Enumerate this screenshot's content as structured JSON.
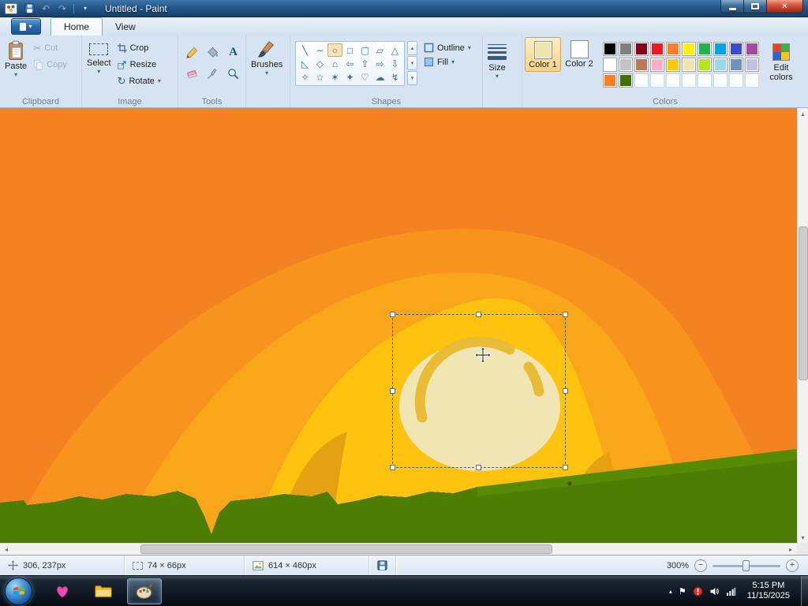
{
  "window": {
    "title": "Untitled - Paint"
  },
  "icons": {
    "undo": "↶",
    "redo": "↷",
    "dropdown": "▾",
    "close": "✕",
    "cut": "✂",
    "rotate": "↻",
    "text_tool": "A",
    "scroll_up": "▴",
    "scroll_down": "▾",
    "scroll_left": "◂",
    "scroll_right": "▸",
    "tray_expand": "▴",
    "action_center_flag": "⚑",
    "zoom_out": "−",
    "zoom_in": "+"
  },
  "tabs": {
    "home": "Home",
    "view": "View"
  },
  "ribbon": {
    "clipboard": {
      "label": "Clipboard",
      "paste": "Paste",
      "cut": "Cut",
      "copy": "Copy"
    },
    "image": {
      "label": "Image",
      "select": "Select",
      "crop": "Crop",
      "resize": "Resize",
      "rotate": "Rotate"
    },
    "tools": {
      "label": "Tools"
    },
    "brushes": {
      "label": "Brushes"
    },
    "shapes": {
      "label": "Shapes",
      "outline": "Outline",
      "fill": "Fill",
      "items": [
        {
          "name": "line",
          "glyph": "╲"
        },
        {
          "name": "curve",
          "glyph": "∼"
        },
        {
          "name": "oval",
          "glyph": "○",
          "selected": true
        },
        {
          "name": "rectangle",
          "glyph": "□"
        },
        {
          "name": "rounded-rectangle",
          "glyph": "▢"
        },
        {
          "name": "polygon",
          "glyph": "▱"
        },
        {
          "name": "triangle",
          "glyph": "△"
        },
        {
          "name": "right-triangle",
          "glyph": "◺"
        },
        {
          "name": "diamond",
          "glyph": "◇"
        },
        {
          "name": "pentagon",
          "glyph": "⌂"
        },
        {
          "name": "left-arrow",
          "glyph": "⇦"
        },
        {
          "name": "up-arrow",
          "glyph": "⇧"
        },
        {
          "name": "right-arrow",
          "glyph": "⇨"
        },
        {
          "name": "down-arrow",
          "glyph": "⇩"
        },
        {
          "name": "four-point-star",
          "glyph": "✧"
        },
        {
          "name": "five-point-star",
          "glyph": "☆"
        },
        {
          "name": "six-point-star",
          "glyph": "✶"
        },
        {
          "name": "four-point-star-filled",
          "glyph": "✦"
        },
        {
          "name": "heart",
          "glyph": "♡"
        },
        {
          "name": "cloud-callout",
          "glyph": "☁"
        },
        {
          "name": "lightning",
          "glyph": "↯"
        }
      ]
    },
    "size": {
      "label": "Size"
    },
    "colors": {
      "label": "Colors",
      "color1_label": "Color 1",
      "color2_label": "Color 2",
      "edit_label": "Edit colors",
      "color1": "#F1E3AE",
      "color2": "#FFFFFF",
      "palette": [
        "#000000",
        "#7F7F7F",
        "#880015",
        "#ED1C24",
        "#FF7F27",
        "#FFF200",
        "#22B14C",
        "#00A2E8",
        "#3F48CC",
        "#A349A4",
        "#FFFFFF",
        "#C3C3C3",
        "#B97A57",
        "#FFAEC9",
        "#FFC90E",
        "#EFE4B0",
        "#B5E61D",
        "#99D9EA",
        "#7092BE",
        "#C8BFE7",
        "#FF7F27",
        "#3F7000",
        null,
        null,
        null,
        null,
        null,
        null,
        null,
        null
      ]
    }
  },
  "canvas": {
    "colors": {
      "sky": "#F58220",
      "glow": "#F8941E",
      "glow2": "#FAA61A",
      "hill": "#FFC20E",
      "hill_shadow": "#E6A113",
      "sun": "#F2E5B4",
      "sun_ring": "#E9BC38",
      "grass": "#4E7D04",
      "grass_light": "#588B05"
    }
  },
  "statusbar": {
    "cursor_position": "306, 237px",
    "selection_size": "74 × 66px",
    "image_size": "614 × 460px",
    "zoom": "300%"
  },
  "taskbar": {
    "time": "5:15 PM",
    "date": "11/15/2025"
  }
}
